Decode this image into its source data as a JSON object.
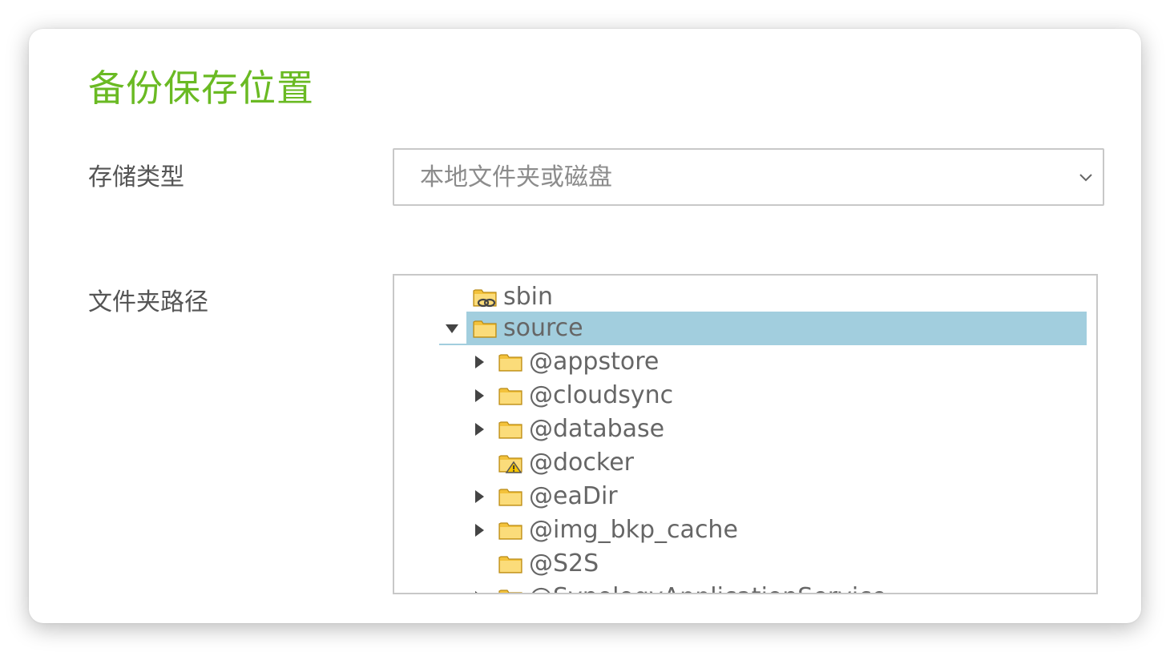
{
  "page": {
    "title": "备份保存位置"
  },
  "storage": {
    "label": "存储类型",
    "value": "本地文件夹或磁盘"
  },
  "path": {
    "label": "文件夹路径"
  },
  "tree": {
    "items": [
      {
        "label": "sbin",
        "icon": "folder-link-icon",
        "toggle": "none",
        "selected": false
      },
      {
        "label": "source",
        "icon": "folder-icon",
        "toggle": "expanded",
        "selected": true
      },
      {
        "label": "@appstore",
        "icon": "folder-icon",
        "toggle": "collapsed",
        "selected": false
      },
      {
        "label": "@cloudsync",
        "icon": "folder-icon",
        "toggle": "collapsed",
        "selected": false
      },
      {
        "label": "@database",
        "icon": "folder-icon",
        "toggle": "collapsed",
        "selected": false
      },
      {
        "label": "@docker",
        "icon": "folder-warning-icon",
        "toggle": "none",
        "selected": false
      },
      {
        "label": "@eaDir",
        "icon": "folder-icon",
        "toggle": "collapsed",
        "selected": false
      },
      {
        "label": "@img_bkp_cache",
        "icon": "folder-icon",
        "toggle": "collapsed",
        "selected": false
      },
      {
        "label": "@S2S",
        "icon": "folder-icon",
        "toggle": "none",
        "selected": false
      },
      {
        "label": "@SynologyApplicationService",
        "icon": "folder-icon",
        "toggle": "collapsed",
        "selected": false
      }
    ]
  },
  "colors": {
    "title": "#6aba23",
    "selection": "#a2cede",
    "folder": "#f3c23b"
  }
}
